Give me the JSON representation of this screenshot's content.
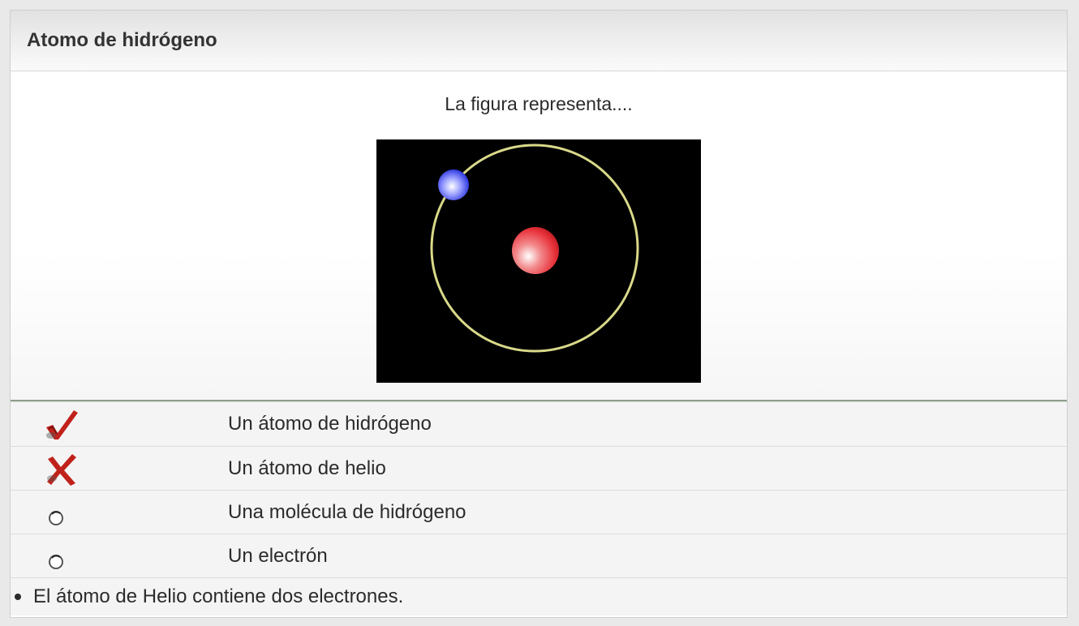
{
  "panel": {
    "title": "Atomo de hidrógeno"
  },
  "question": {
    "prompt": "La figura representa....",
    "figure": {
      "background": "#000000",
      "orbit_color": "#d9d98a",
      "nucleus_color": "#e8323a",
      "electron_color": "#2f38e0"
    }
  },
  "answers": [
    {
      "label": "Un átomo de hidrógeno",
      "status": "check-icon"
    },
    {
      "label": "Un átomo de helio",
      "status": "cross-icon"
    },
    {
      "label": "Una molécula de hidrógeno",
      "status": "radio-icon"
    },
    {
      "label": "Un electrón",
      "status": "radio-icon"
    }
  ],
  "feedback": {
    "text": "El átomo de Helio contiene dos electrones."
  },
  "colors": {
    "mark_red": "#c0221b",
    "divider_green": "#8e9e8a"
  }
}
